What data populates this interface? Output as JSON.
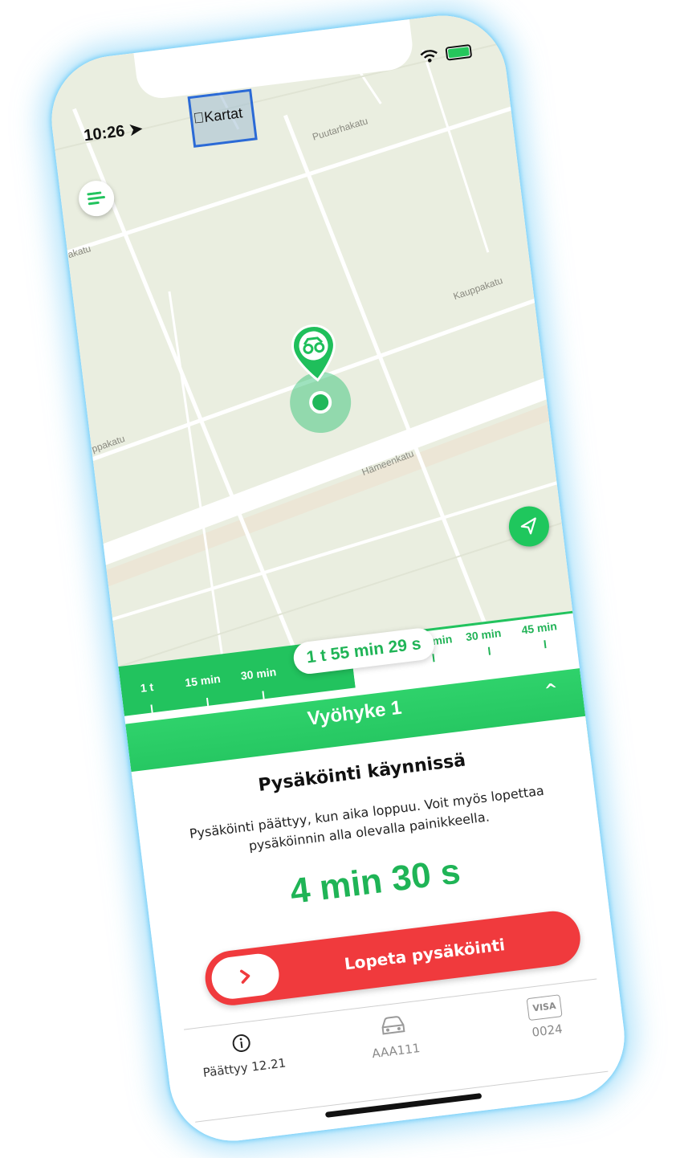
{
  "status_bar": {
    "time": "10:26"
  },
  "map": {
    "attribution": "Kartat",
    "streets": [
      "Puutarhakatu",
      "akatu",
      "Kauppakatu",
      "ppakatu",
      "Hämeenkatu"
    ]
  },
  "icons": {
    "menu": "menu-icon",
    "locate": "location-arrow-icon",
    "parking_pin": "car-pin-icon",
    "stop_chevron": "chevron-right-icon",
    "info": "info-icon",
    "car": "car-icon",
    "card": "visa-card-icon"
  },
  "colors": {
    "accent": "#22c35e",
    "danger": "#f03a3d",
    "text": "#111111"
  },
  "timeline": {
    "elapsed_labels": [
      "1 t",
      "15 min",
      "30 min"
    ],
    "upcoming_labels": [
      "min",
      "30 min",
      "45 min"
    ],
    "current_duration": "1 t 55 min 29 s"
  },
  "zone": {
    "title": "Vyöhyke 1"
  },
  "parking": {
    "title": "Pysäköinti käynnissä",
    "description_line1": "Pysäköinti päättyy, kun aika loppuu. Voit myös lopettaa",
    "description_line2": "pysäköinnin alla olevalla painikkeella.",
    "remaining": "4 min 30 s",
    "stop_label": "Lopeta pysäköinti"
  },
  "info_bar": {
    "end_time": "Päättyy 12.21",
    "plate": "AAA111",
    "card_brand": "VISA",
    "card_last4": "0024"
  }
}
